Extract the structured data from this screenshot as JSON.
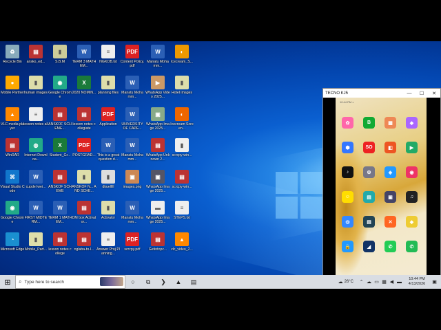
{
  "desktop_icons": [
    {
      "label": "Recycle Bin",
      "color": "#8ab",
      "glyph": "♻"
    },
    {
      "label": "ansko_ed...",
      "color": "#b33",
      "glyph": "▤"
    },
    {
      "label": "S.B.M",
      "color": "#cc9",
      "glyph": "▮"
    },
    {
      "label": "TERM 3 MATHEM...",
      "color": "#2b5fb5",
      "glyph": "W"
    },
    {
      "label": "NGKOB.txt",
      "color": "#eee",
      "glyph": "≡"
    },
    {
      "label": "Content Policy.pdf",
      "color": "#d22",
      "glyph": "PDF"
    },
    {
      "label": "Manatu Mohamm...",
      "color": "#2b5fb5",
      "glyph": "W"
    },
    {
      "label": "Icecream_S...",
      "color": "#e90",
      "glyph": "◐"
    },
    {
      "label": "Mobile Partner",
      "color": "#fa0",
      "glyph": "●"
    },
    {
      "label": "human images",
      "color": "#dda",
      "glyph": "▮"
    },
    {
      "label": "Google Chrome",
      "color": "#2a8",
      "glyph": "◉"
    },
    {
      "label": "2020 NOMIN...",
      "color": "#1a7a3a",
      "glyph": "X"
    },
    {
      "label": "planning files",
      "color": "#dda",
      "glyph": "▮"
    },
    {
      "label": "Manatu Mohamm...",
      "color": "#2b5fb5",
      "glyph": "W"
    },
    {
      "label": "WhatsApp Video 2025...",
      "color": "#c96",
      "glyph": "▶"
    },
    {
      "label": "Hotel images",
      "color": "#dda",
      "glyph": "▮"
    },
    {
      "label": "VLC media player",
      "color": "#f80",
      "glyph": "▲"
    },
    {
      "label": "lesson notes all",
      "color": "#eee",
      "glyph": "≡"
    },
    {
      "label": "ANSKOF SCHEME...",
      "color": "#b33",
      "glyph": "▤"
    },
    {
      "label": "lesson notes collegiate",
      "color": "#b33",
      "glyph": "▤"
    },
    {
      "label": "Application",
      "color": "#d22",
      "glyph": "PDF"
    },
    {
      "label": "UNIVERSITY OF CAPE...",
      "color": "#2b5fb5",
      "glyph": "W"
    },
    {
      "label": "WhatsApp Image 2025...",
      "color": "#8a8",
      "glyph": "▣"
    },
    {
      "label": "Icecream Screen...",
      "color": "#e60",
      "glyph": "◐"
    },
    {
      "label": "WinRAR",
      "color": "#b33",
      "glyph": "▤"
    },
    {
      "label": "Internet Downloa...",
      "color": "#2a8",
      "glyph": "◍"
    },
    {
      "label": "Student_Gr...",
      "color": "#1a7a3a",
      "glyph": "X"
    },
    {
      "label": "POSTGRAD...",
      "color": "#d22",
      "glyph": "PDF"
    },
    {
      "label": "This is a great question d...",
      "color": "#2b5fb5",
      "glyph": "W"
    },
    {
      "label": "Manatu Mohamm...",
      "color": "#2b5fb5",
      "glyph": "W"
    },
    {
      "label": "WhatsApp Unknown 2...",
      "color": "#b33",
      "glyph": "▤"
    },
    {
      "label": "scrcpy-win...",
      "color": "#eee",
      "glyph": "▮"
    },
    {
      "label": "Visual Studio Code",
      "color": "#17c",
      "glyph": "⌘"
    },
    {
      "label": "cupdel wei...",
      "color": "#2b5fb5",
      "glyph": "W"
    },
    {
      "label": "ANSKOF SCHEME",
      "color": "#b33",
      "glyph": "▤"
    },
    {
      "label": "ANSKOF N... AND SCHE...",
      "color": "#dda",
      "glyph": "▮"
    },
    {
      "label": "dkuelllll",
      "color": "#ddd",
      "glyph": "▮"
    },
    {
      "label": "images.png",
      "color": "#c85",
      "glyph": "▣"
    },
    {
      "label": "WhatsApp Image 2025...",
      "color": "#556",
      "glyph": "▣"
    },
    {
      "label": "scrcpy-win...",
      "color": "#b33",
      "glyph": "▤"
    },
    {
      "label": "Google Chrome",
      "color": "#2a8",
      "glyph": "◉"
    },
    {
      "label": "FIRST MIDTERM...",
      "color": "#2b5fb5",
      "glyph": "W"
    },
    {
      "label": "TERM 1 MATHEM...",
      "color": "#2b5fb5",
      "glyph": "W"
    },
    {
      "label": "DM box Activator...",
      "color": "#b33",
      "glyph": "▤"
    },
    {
      "label": "Activator",
      "color": "#dda",
      "glyph": "▮"
    },
    {
      "label": "Manatu Mohamm...",
      "color": "#2b5fb5",
      "glyph": "W"
    },
    {
      "label": "WhatsApp Image 2025...",
      "color": "#eee",
      "glyph": "▬"
    },
    {
      "label": "STEPS.txt",
      "color": "#eee",
      "glyph": "≡"
    },
    {
      "label": "Microsoft Edge",
      "color": "#1a8fd0",
      "glyph": "◔"
    },
    {
      "label": "Mobile_Part...",
      "color": "#dda",
      "glyph": "▮"
    },
    {
      "label": "lesson notes college",
      "color": "#b33",
      "glyph": "▤"
    },
    {
      "label": "nglaba-to-l...",
      "color": "#b33",
      "glyph": "▤"
    },
    {
      "label": "Answer Proj Planning...",
      "color": "#eee",
      "glyph": "≡"
    },
    {
      "label": "scrcpy.pdf",
      "color": "#d22",
      "glyph": "PDF"
    },
    {
      "label": "Getintopc...",
      "color": "#b33",
      "glyph": "▤"
    },
    {
      "label": "vlc_video_2...",
      "color": "#f80",
      "glyph": "▲"
    }
  ],
  "phone_window": {
    "title": "TECNO KJ5",
    "minimize": "—",
    "maximize": "☐",
    "close": "✕",
    "status_time": "10:44 PM ◐"
  },
  "phone_apps": [
    {
      "name": "Photos",
      "color": "#f6a",
      "glyph": "✿"
    },
    {
      "name": "Boomplay",
      "color": "#1a3",
      "glyph": "B"
    },
    {
      "name": "Apps",
      "color": "#e85",
      "glyph": "▦"
    },
    {
      "name": "AI Gallery",
      "color": "#a6f",
      "glyph": "◆"
    },
    {
      "name": "Cloud",
      "color": "#37f",
      "glyph": "⬢"
    },
    {
      "name": "SO",
      "color": "#e22",
      "glyph": "SO"
    },
    {
      "name": "Office",
      "color": "#e52",
      "glyph": "◧"
    },
    {
      "name": "Meet",
      "color": "#2a6",
      "glyph": "▶"
    },
    {
      "name": "TikTok",
      "color": "#111",
      "glyph": "♪"
    },
    {
      "name": "Settings",
      "color": "#778",
      "glyph": "⚙"
    },
    {
      "name": "Shield",
      "color": "#29f",
      "glyph": "◈"
    },
    {
      "name": "Game",
      "color": "#e36",
      "glyph": "◉"
    },
    {
      "name": "Snapchat",
      "color": "#fd0",
      "glyph": "☺"
    },
    {
      "name": "Notes",
      "color": "#2aa",
      "glyph": "▤"
    },
    {
      "name": "Files",
      "color": "#446",
      "glyph": "▣"
    },
    {
      "name": "Music",
      "color": "#222",
      "glyph": "♫"
    },
    {
      "name": "Scanner",
      "color": "#38f",
      "glyph": "◎"
    },
    {
      "name": "Carlcare",
      "color": "#245",
      "glyph": "▤"
    },
    {
      "name": "Xender",
      "color": "#f62",
      "glyph": "✕"
    },
    {
      "name": "Tools",
      "color": "#ec3",
      "glyph": "◆"
    },
    {
      "name": "Security",
      "color": "#29f",
      "glyph": "🔒"
    },
    {
      "name": "Wallpaper",
      "color": "#136",
      "glyph": "◢"
    },
    {
      "name": "WhatsApp",
      "color": "#2c5",
      "glyph": "✆"
    },
    {
      "name": "WA Business",
      "color": "#2b5",
      "glyph": "✆"
    }
  ],
  "phone_dock": [
    {
      "name": "Phone",
      "color": "#2c5",
      "glyph": "✆"
    },
    {
      "name": "Messages",
      "color": "#27e",
      "glyph": "✉"
    },
    {
      "name": "Camera",
      "color": "#222",
      "glyph": "◉"
    },
    {
      "name": "Chrome",
      "color": "#e44",
      "glyph": "◉"
    }
  ],
  "phone_nav": [
    "≡",
    "○",
    "◁"
  ],
  "taskbar": {
    "start_glyph": "⊞",
    "search_placeholder": "Type here to search",
    "search_glyph": "⌕",
    "pinned": [
      {
        "name": "cortana",
        "glyph": "○"
      },
      {
        "name": "task-view",
        "glyph": "⧉"
      },
      {
        "name": "powershell",
        "glyph": "❯"
      },
      {
        "name": "scrcpy",
        "glyph": "▲"
      },
      {
        "name": "notepad",
        "glyph": "▤"
      }
    ],
    "weather": "26°C",
    "clock_time": "10:44 PM",
    "clock_date": "4/13/2026"
  }
}
